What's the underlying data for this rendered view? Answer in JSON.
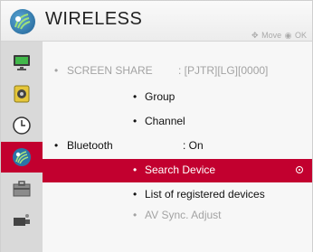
{
  "header": {
    "title": "WIRELESS",
    "hint_move": "Move",
    "hint_ok": "OK",
    "icon": "wireless-icon"
  },
  "sidebar": {
    "items": [
      {
        "icon": "picture-icon",
        "active": false
      },
      {
        "icon": "audio-icon",
        "active": false
      },
      {
        "icon": "clock-icon",
        "active": false
      },
      {
        "icon": "wireless-icon",
        "active": true
      },
      {
        "icon": "toolbox-icon",
        "active": false
      },
      {
        "icon": "camera-icon",
        "active": false
      }
    ]
  },
  "menu": {
    "screen_share_label": "SCREEN SHARE",
    "screen_share_value": ": [PJTR][LG][0000]",
    "group_label": "Group",
    "channel_label": "Channel",
    "bluetooth_label": "Bluetooth",
    "bluetooth_value": ": On",
    "search_device_label": "Search Device",
    "registered_label": "List of registered devices",
    "av_sync_label": "AV Sync. Adjust"
  },
  "colors": {
    "accent": "#c2002f",
    "disabled_text": "#a3a3a3"
  }
}
